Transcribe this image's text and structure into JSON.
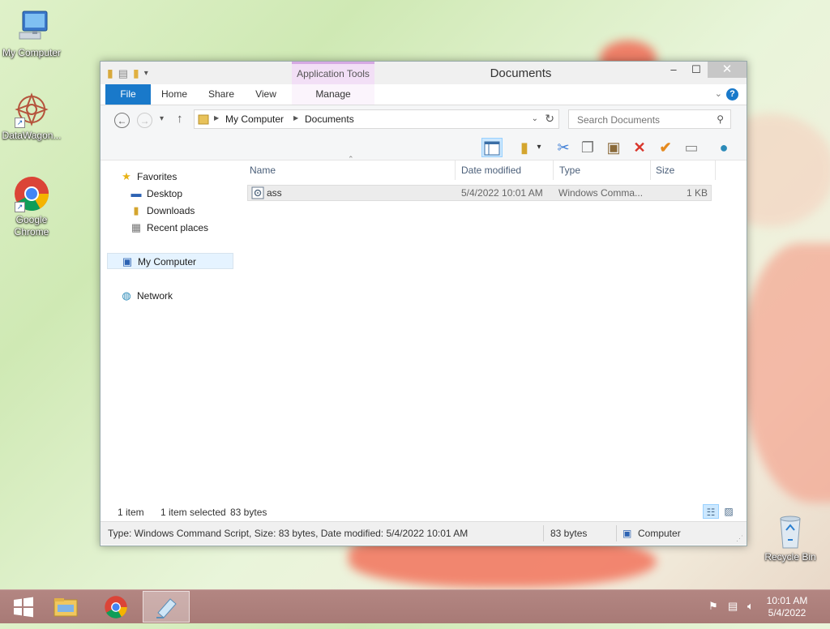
{
  "desktop": {
    "icons": [
      {
        "label": "My Computer"
      },
      {
        "label": "DataWagon..."
      },
      {
        "label": "Google Chrome"
      },
      {
        "label": "Recycle Bin"
      }
    ]
  },
  "window": {
    "title": "Documents",
    "contextual_tab": "Application Tools",
    "tabs": {
      "file": "File",
      "home": "Home",
      "share": "Share",
      "view": "View",
      "manage": "Manage"
    },
    "help_label": "?",
    "address": {
      "crumbs": [
        "My Computer",
        "Documents"
      ]
    },
    "search": {
      "placeholder": "Search Documents",
      "value": ""
    },
    "navpane": {
      "favorites": "Favorites",
      "desktop": "Desktop",
      "downloads": "Downloads",
      "recent": "Recent places",
      "computer": "My Computer",
      "network": "Network"
    },
    "columns": {
      "name": "Name",
      "date": "Date modified",
      "type": "Type",
      "size": "Size"
    },
    "files": [
      {
        "name": "ass",
        "date": "5/4/2022 10:01 AM",
        "type": "Windows Comma...",
        "size": "1 KB"
      }
    ],
    "status": {
      "count": "1 item",
      "selected": "1 item selected",
      "bytes": "83 bytes"
    },
    "details": {
      "info": "Type: Windows Command Script, Size: 83 bytes, Date modified: 5/4/2022 10:01 AM",
      "size": "83 bytes",
      "location": "Computer"
    }
  },
  "taskbar": {
    "clock_time": "10:01 AM",
    "clock_date": "5/4/2022"
  }
}
